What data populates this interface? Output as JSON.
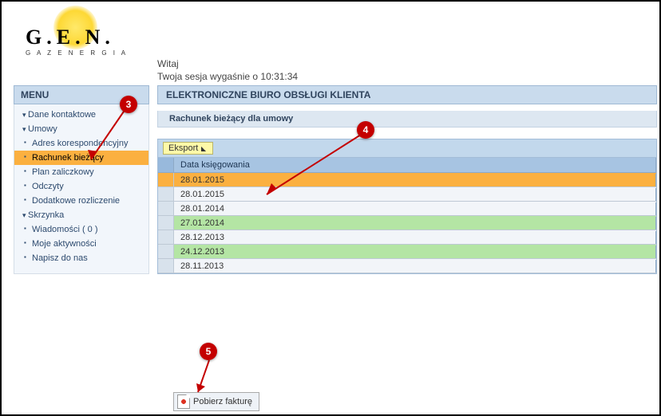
{
  "logo": {
    "brand": "G.E.N.",
    "sub": "G A Z   E N E R G I A"
  },
  "welcome": {
    "line1": "Witaj",
    "line2": "Twoja sesja wygaśnie o 10:31:34"
  },
  "menu": {
    "title": "MENU",
    "sections": [
      {
        "label": "Dane kontaktowe",
        "items": []
      },
      {
        "label": "Umowy",
        "items": [
          {
            "label": "Adres korespondencyjny",
            "active": false
          },
          {
            "label": "Rachunek bieżący",
            "active": true
          },
          {
            "label": "Plan zaliczkowy",
            "active": false
          },
          {
            "label": "Odczyty",
            "active": false
          },
          {
            "label": "Dodatkowe rozliczenie",
            "active": false
          }
        ]
      },
      {
        "label": "Skrzynka",
        "items": [
          {
            "label": "Wiadomości ( 0 )",
            "active": false
          },
          {
            "label": "Moje aktywności",
            "active": false
          },
          {
            "label": "Napisz do nas",
            "active": false
          }
        ]
      }
    ]
  },
  "main": {
    "title": "ELEKTRONICZNE BIURO OBSŁUGI KLIENTA",
    "subtitle": "Rachunek bieżący dla umowy",
    "export": "Eksport",
    "columns": {
      "date": "Data księgowania"
    },
    "rows": [
      {
        "date": "28.01.2015",
        "style": "selected"
      },
      {
        "date": "28.01.2015",
        "style": "default"
      },
      {
        "date": "28.01.2014",
        "style": "default"
      },
      {
        "date": "27.01.2014",
        "style": "green"
      },
      {
        "date": "28.12.2013",
        "style": "default"
      },
      {
        "date": "24.12.2013",
        "style": "green"
      },
      {
        "date": "28.11.2013",
        "style": "default"
      }
    ]
  },
  "download": {
    "label": "Pobierz fakturę"
  },
  "annotations": {
    "a3": "3",
    "a4": "4",
    "a5": "5"
  }
}
